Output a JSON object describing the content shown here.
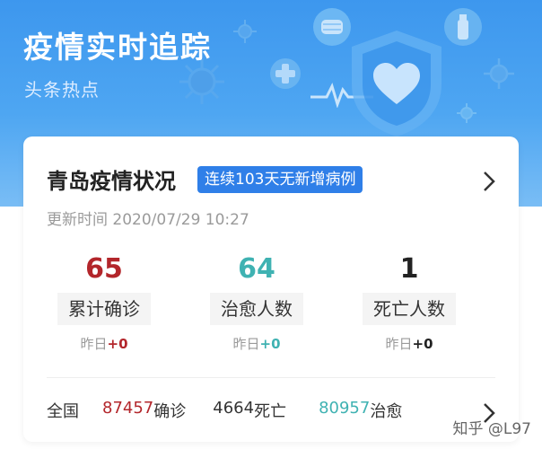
{
  "header": {
    "title": "疫情实时追踪",
    "subtitle": "头条热点"
  },
  "card": {
    "city_title": "青岛疫情状况",
    "badge": "连续103天无新增病例",
    "update_time": "更新时间 2020/07/29 10:27",
    "stats": [
      {
        "value": "65",
        "label": "累计确诊",
        "diff_prefix": "昨日",
        "diff": "+0",
        "color": "#b3262b"
      },
      {
        "value": "64",
        "label": "治愈人数",
        "diff_prefix": "昨日",
        "diff": "+0",
        "color": "#3fb2b2"
      },
      {
        "value": "1",
        "label": "死亡人数",
        "diff_prefix": "昨日",
        "diff": "+0",
        "color": "#222222"
      }
    ],
    "national": {
      "label": "全国",
      "confirmed_value": "87457",
      "confirmed_label": "确诊",
      "deaths_value": "4664",
      "deaths_label": "死亡",
      "cured_value": "80957",
      "cured_label": "治愈"
    }
  },
  "watermark": "知乎 @L97",
  "colors": {
    "header_blue": "#3d97ee",
    "badge_blue": "#2f7fe8",
    "confirmed_red": "#b3262b",
    "cured_teal": "#3fb2b2"
  },
  "icons": [
    "virus-icon",
    "mask-icon",
    "medical-cross-icon",
    "shield-heart-icon",
    "spray-bottle-icon",
    "heartbeat-line-icon",
    "chevron-right-icon"
  ]
}
